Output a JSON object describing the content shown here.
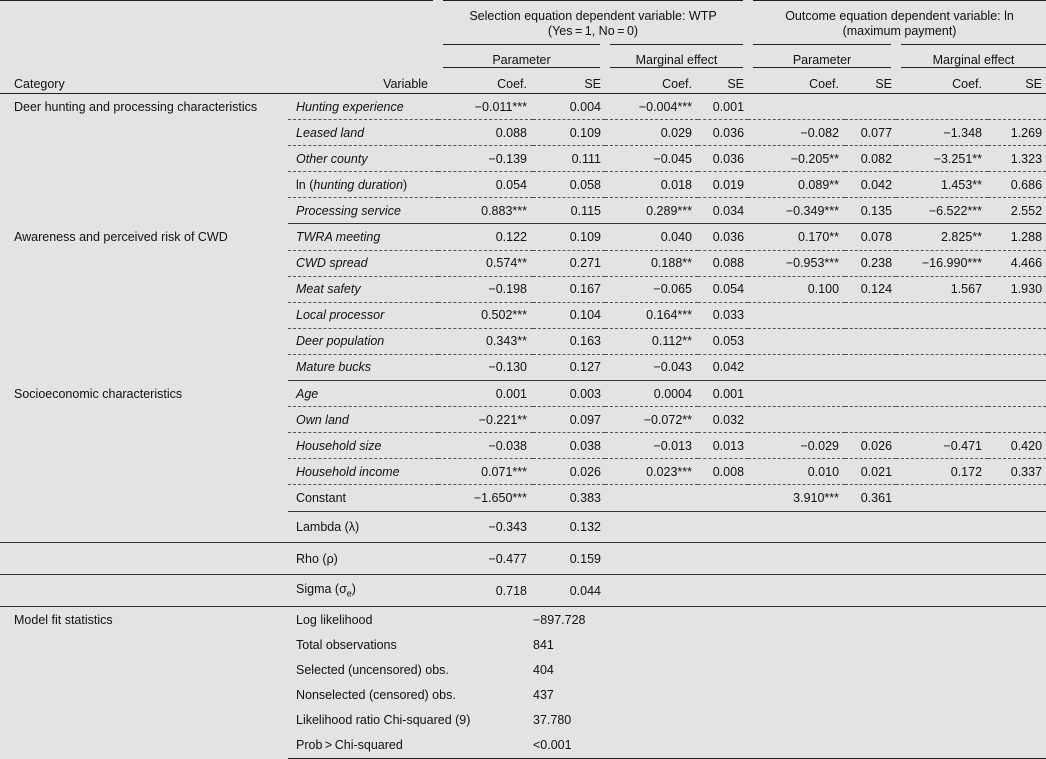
{
  "header": {
    "selection_title": "Selection equation dependent variable: WTP",
    "selection_sub": "(Yes = 1, No = 0)",
    "outcome_title": "Outcome equation dependent variable: ln",
    "outcome_sub": "(maximum payment)",
    "parameter": "Parameter",
    "marginal_effect": "Marginal effect",
    "category": "Category",
    "variable": "Variable",
    "coef": "Coef.",
    "se": "SE"
  },
  "categories": {
    "deer": "Deer hunting and processing characteristics",
    "awareness": "Awareness and perceived risk of CWD",
    "socio": "Socioeconomic characteristics",
    "fit": "Model fit statistics"
  },
  "rows": [
    {
      "var": "Hunting experience",
      "v": [
        "−0.011***",
        "0.004",
        "−0.004***",
        "0.001",
        "",
        "",
        "",
        ""
      ]
    },
    {
      "var": "Leased land",
      "v": [
        "0.088",
        "0.109",
        "0.029",
        "0.036",
        "−0.082",
        "0.077",
        "−1.348",
        "1.269"
      ]
    },
    {
      "var": "Other county",
      "v": [
        "−0.139",
        "0.111",
        "−0.045",
        "0.036",
        "−0.205**",
        "0.082",
        "−3.251**",
        "1.323"
      ]
    },
    {
      "var_pre": "ln (",
      "var_it": "hunting duration",
      "var_post": ")",
      "v": [
        "0.054",
        "0.058",
        "0.018",
        "0.019",
        "0.089**",
        "0.042",
        "1.453**",
        "0.686"
      ]
    },
    {
      "var": "Processing service",
      "v": [
        "0.883***",
        "0.115",
        "0.289***",
        "0.034",
        "−0.349***",
        "0.135",
        "−6.522***",
        "2.552"
      ]
    },
    {
      "var": "TWRA meeting",
      "v": [
        "0.122",
        "0.109",
        "0.040",
        "0.036",
        "0.170**",
        "0.078",
        "2.825**",
        "1.288"
      ]
    },
    {
      "var": "CWD spread",
      "v": [
        "0.574**",
        "0.271",
        "0.188**",
        "0.088",
        "−0.953***",
        "0.238",
        "−16.990***",
        "4.466"
      ]
    },
    {
      "var": "Meat safety",
      "v": [
        "−0.198",
        "0.167",
        "−0.065",
        "0.054",
        "0.100",
        "0.124",
        "1.567",
        "1.930"
      ]
    },
    {
      "var": "Local processor",
      "v": [
        "0.502***",
        "0.104",
        "0.164***",
        "0.033",
        "",
        "",
        "",
        ""
      ]
    },
    {
      "var": "Deer population",
      "v": [
        "0.343**",
        "0.163",
        "0.112**",
        "0.053",
        "",
        "",
        "",
        ""
      ]
    },
    {
      "var": "Mature bucks",
      "v": [
        "−0.130",
        "0.127",
        "−0.043",
        "0.042",
        "",
        "",
        "",
        ""
      ]
    },
    {
      "var": "Age",
      "v": [
        "0.001",
        "0.003",
        "0.0004",
        "0.001",
        "",
        "",
        "",
        ""
      ]
    },
    {
      "var": "Own land",
      "v": [
        "−0.221**",
        "0.097",
        "−0.072**",
        "0.032",
        "",
        "",
        "",
        ""
      ]
    },
    {
      "var": "Household size",
      "v": [
        "−0.038",
        "0.038",
        "−0.013",
        "0.013",
        "−0.029",
        "0.026",
        "−0.471",
        "0.420"
      ]
    },
    {
      "var": "Household income",
      "v": [
        "0.071***",
        "0.026",
        "0.023***",
        "0.008",
        "0.010",
        "0.021",
        "0.172",
        "0.337"
      ]
    },
    {
      "var": "Constant",
      "v": [
        "−1.650***",
        "0.383",
        "",
        "",
        "3.910***",
        "0.361",
        "",
        ""
      ]
    },
    {
      "var": "Lambda (λ)",
      "v": [
        "−0.343",
        "0.132",
        "",
        "",
        "",
        "",
        "",
        ""
      ]
    },
    {
      "var": "Rho (ρ)",
      "v": [
        "−0.477",
        "0.159",
        "",
        "",
        "",
        "",
        "",
        ""
      ]
    },
    {
      "var_pre": "Sigma (σ",
      "var_sub": "e",
      "var_post": ")",
      "v": [
        "0.718",
        "0.044",
        "",
        "",
        "",
        "",
        "",
        ""
      ]
    }
  ],
  "fit": [
    {
      "label": "Log likelihood",
      "value": "−897.728"
    },
    {
      "label": "Total observations",
      "value": "841"
    },
    {
      "label": "Selected (uncensored) obs.",
      "value": "404"
    },
    {
      "label": "Nonselected (censored) obs.",
      "value": "437"
    },
    {
      "label": "Likelihood ratio Chi-squared (9)",
      "value": "37.780"
    },
    {
      "label": "Prob > Chi-squared",
      "value": "<0.001"
    }
  ]
}
